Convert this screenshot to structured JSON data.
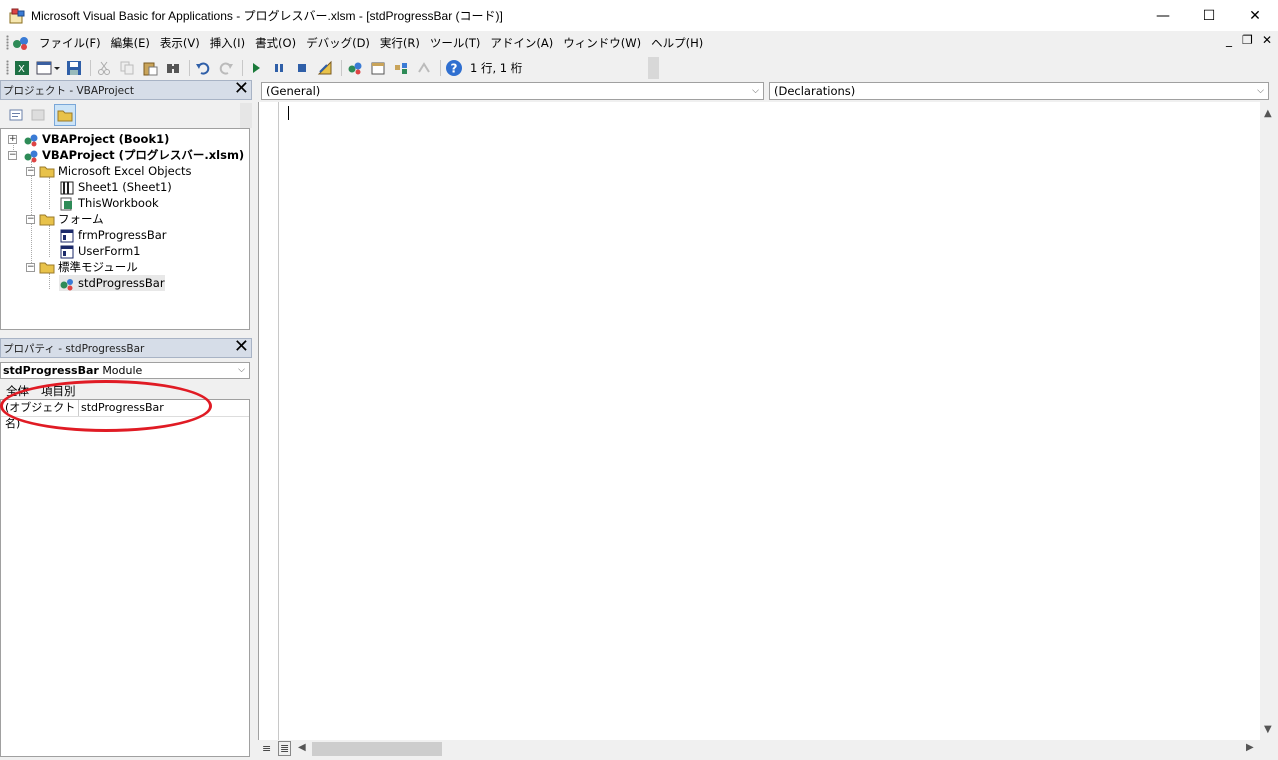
{
  "window": {
    "title": "Microsoft Visual Basic for Applications - プログレスバー.xlsm - [stdProgressBar (コード)]",
    "minimize": "—",
    "maximize": "☐",
    "close": "✕"
  },
  "menu": {
    "items": [
      "ファイル(F)",
      "編集(E)",
      "表示(V)",
      "挿入(I)",
      "書式(O)",
      "デバッグ(D)",
      "実行(R)",
      "ツール(T)",
      "アドイン(A)",
      "ウィンドウ(W)",
      "ヘルプ(H)"
    ],
    "mdi_minimize": "_",
    "mdi_restore": "❐",
    "mdi_close": "✕"
  },
  "toolbar": {
    "position_text": "1 行, 1 桁"
  },
  "project_pane": {
    "title": "プロジェクト - VBAProject",
    "close": "✕",
    "tree": [
      {
        "label": "VBAProject (Book1)",
        "bold": true,
        "expander": "+"
      },
      {
        "label": "VBAProject (プログレスバー.xlsm)",
        "bold": true,
        "expander": "−"
      },
      {
        "label": "Microsoft Excel Objects",
        "expander": "−"
      },
      {
        "label": "Sheet1 (Sheet1)"
      },
      {
        "label": "ThisWorkbook"
      },
      {
        "label": "フォーム",
        "expander": "−"
      },
      {
        "label": "frmProgressBar"
      },
      {
        "label": "UserForm1"
      },
      {
        "label": "標準モジュール",
        "expander": "−"
      },
      {
        "label": "stdProgressBar"
      }
    ]
  },
  "properties_pane": {
    "title": "プロパティ - stdProgressBar",
    "close": "✕",
    "object_name": "stdProgressBar",
    "object_type": "Module",
    "tabs": [
      "全体",
      "項目別"
    ],
    "rows": [
      {
        "name": "(オブジェクト名)",
        "value": "stdProgressBar"
      }
    ]
  },
  "code_window": {
    "object_combo": "(General)",
    "procedure_combo": "(Declarations)",
    "combo_arrow": "⌵"
  },
  "colors": {
    "pane_header": "#d6dde8",
    "annotation_ellipse": "#e01b24"
  }
}
